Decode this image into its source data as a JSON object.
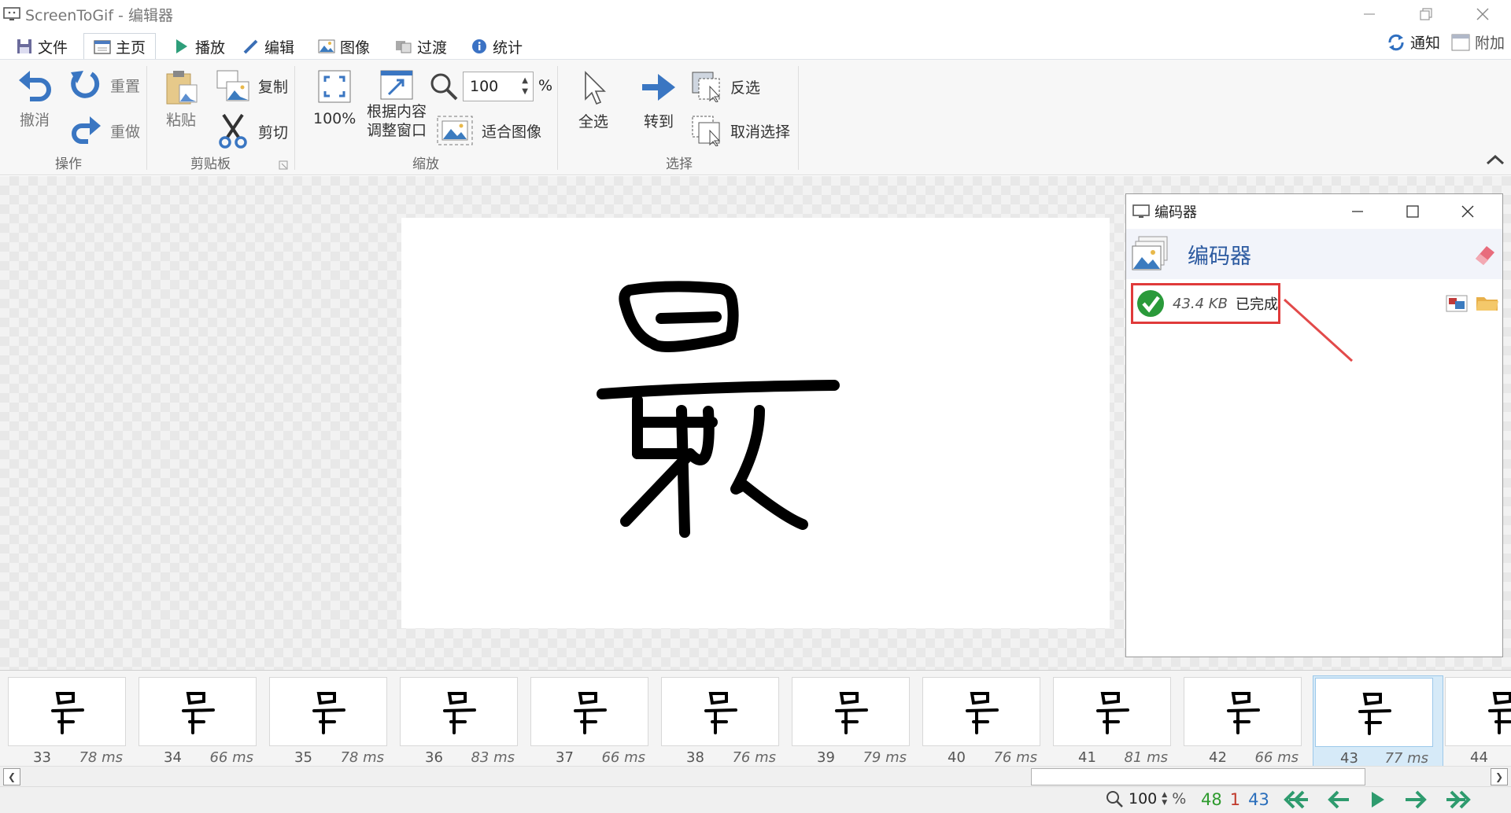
{
  "window": {
    "title": "ScreenToGif - 编辑器"
  },
  "tabs": [
    {
      "label": "文件",
      "icon": "save-icon"
    },
    {
      "label": "主页",
      "icon": "home-icon",
      "active": true
    },
    {
      "label": "播放",
      "icon": "play-icon"
    },
    {
      "label": "编辑",
      "icon": "pencil-icon"
    },
    {
      "label": "图像",
      "icon": "image-icon"
    },
    {
      "label": "过渡",
      "icon": "transition-icon"
    },
    {
      "label": "统计",
      "icon": "info-icon"
    }
  ],
  "right_tabs": {
    "notify": "通知",
    "extras": "附加"
  },
  "ribbon": {
    "undo": "撤消",
    "reset": "重置",
    "redo": "重做",
    "group_actions": "操作",
    "paste": "粘贴",
    "copy": "复制",
    "cut": "剪切",
    "group_clipboard": "剪贴板",
    "zoom100": "100%",
    "fit_window": "根据内容\n调整窗口",
    "fit_window_l1": "根据内容",
    "fit_window_l2": "调整窗口",
    "zoom_value": "100",
    "zoom_unit": "%",
    "fit_image": "适合图像",
    "group_zoom": "缩放",
    "select_all": "全选",
    "goto": "转到",
    "invert": "反选",
    "deselect": "取消选择",
    "group_select": "选择"
  },
  "encoder": {
    "window_title": "编码器",
    "header": "编码器",
    "item": {
      "size": "43.4 KB",
      "status": "已完成"
    }
  },
  "frames": [
    {
      "num": "33",
      "ms": "78 ms"
    },
    {
      "num": "34",
      "ms": "66 ms"
    },
    {
      "num": "35",
      "ms": "78 ms"
    },
    {
      "num": "36",
      "ms": "83 ms"
    },
    {
      "num": "37",
      "ms": "66 ms"
    },
    {
      "num": "38",
      "ms": "76 ms"
    },
    {
      "num": "39",
      "ms": "79 ms"
    },
    {
      "num": "40",
      "ms": "76 ms"
    },
    {
      "num": "41",
      "ms": "81 ms"
    },
    {
      "num": "42",
      "ms": "66 ms"
    },
    {
      "num": "43",
      "ms": "77 ms",
      "selected": true
    },
    {
      "num": "44",
      "ms": ""
    }
  ],
  "statusbar": {
    "zoom": "100",
    "zoom_unit": "%",
    "total": "48",
    "selected_count": "1",
    "current": "43",
    "colors": {
      "total": "#2e9b2e",
      "selected": "#c0392b",
      "current": "#2a6ebb"
    }
  }
}
